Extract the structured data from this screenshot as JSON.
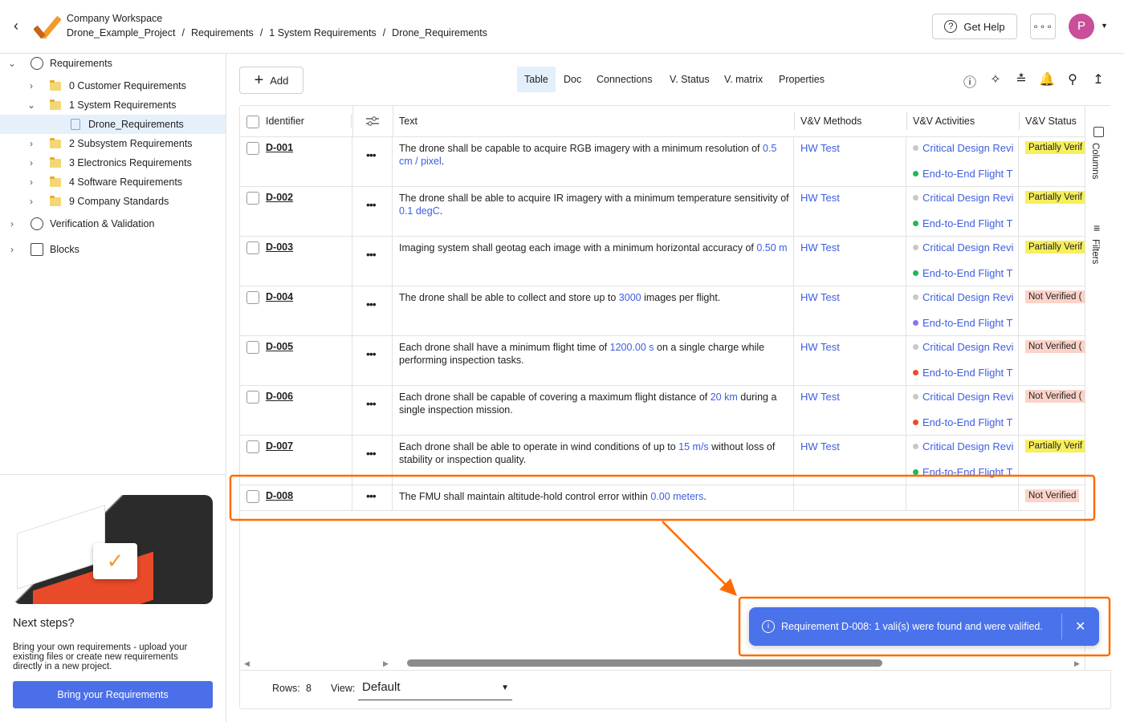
{
  "header": {
    "workspace": "Company Workspace",
    "breadcrumb": [
      "Drone_Example_Project",
      "Requirements",
      "1 System Requirements",
      "Drone_Requirements"
    ],
    "help_label": "Get Help",
    "avatar_letter": "P",
    "avatar_color": "#c94f9b"
  },
  "sidebar": {
    "items": [
      {
        "label": "Requirements",
        "level": 0,
        "expanded": true,
        "icon": "requirements-icon"
      },
      {
        "label": "0 Customer Requirements",
        "level": 1,
        "expanded": false,
        "icon": "folder-icon"
      },
      {
        "label": "1 System Requirements",
        "level": 1,
        "expanded": true,
        "icon": "folder-icon"
      },
      {
        "label": "Drone_Requirements",
        "level": 2,
        "selected": true,
        "icon": "document-icon"
      },
      {
        "label": "2 Subsystem Requirements",
        "level": 1,
        "expanded": false,
        "icon": "folder-icon"
      },
      {
        "label": "3 Electronics Requirements",
        "level": 1,
        "expanded": false,
        "icon": "folder-icon"
      },
      {
        "label": "4 Software Requirements",
        "level": 1,
        "expanded": false,
        "icon": "folder-icon"
      },
      {
        "label": "9 Company Standards",
        "level": 1,
        "expanded": false,
        "icon": "folder-icon"
      },
      {
        "label": "Verification & Validation",
        "level": 0,
        "expanded": false,
        "icon": "verification-icon"
      },
      {
        "label": "Blocks",
        "level": 0,
        "expanded": false,
        "icon": "blocks-icon"
      }
    ],
    "promo": {
      "title": "Next steps?",
      "body": "Bring your own requirements - upload your existing files or create new requirements directly in a new project.",
      "button": "Bring your Requirements"
    }
  },
  "toolbar": {
    "add_label": "Add",
    "tabs": [
      "Table",
      "Doc",
      "Connections",
      "V. Status",
      "V. matrix",
      "Properties"
    ],
    "active_tab": "Table",
    "icons": [
      "info-icon",
      "sparkle-icon",
      "chart-icon",
      "bell-icon",
      "search-icon",
      "upload-icon"
    ]
  },
  "table": {
    "columns": [
      "Identifier",
      "Text",
      "V&V Methods",
      "V&V Activities",
      "V&V Status"
    ],
    "side_panel": [
      "Columns",
      "Filters"
    ],
    "rows": [
      {
        "id": "D-001",
        "text": [
          [
            "The drone shall be capable to acquire RGB imagery with a minimum resolution of ",
            0
          ],
          [
            "0.5  cm / pixel",
            1
          ],
          [
            ".",
            0
          ]
        ],
        "method": "HW Test",
        "activities": [
          [
            "Critical Design Revi",
            "#c8c8c8"
          ],
          [
            "End-to-End Flight T",
            "#1db954"
          ]
        ],
        "status": "Partially Verif",
        "status_color": "#f7ef5b"
      },
      {
        "id": "D-002",
        "text": [
          [
            "The drone shall be able to acquire IR imagery with a minimum temperature sensitivity of ",
            0
          ],
          [
            "0.1  degC",
            1
          ],
          [
            ".",
            0
          ]
        ],
        "method": "HW Test",
        "activities": [
          [
            "Critical Design Revi",
            "#c8c8c8"
          ],
          [
            "End-to-End Flight T",
            "#1db954"
          ]
        ],
        "status": "Partially Verif",
        "status_color": "#f7ef5b"
      },
      {
        "id": "D-003",
        "text": [
          [
            "Imaging system shall geotag each image with a minimum horizontal accuracy of ",
            0
          ],
          [
            "0.50  m",
            1
          ]
        ],
        "method": "HW Test",
        "activities": [
          [
            "Critical Design Revi",
            "#c8c8c8"
          ],
          [
            "End-to-End Flight T",
            "#1db954"
          ]
        ],
        "status": "Partially Verif",
        "status_color": "#f7ef5b"
      },
      {
        "id": "D-004",
        "text": [
          [
            "The drone shall be able to collect and store up to ",
            0
          ],
          [
            "3000",
            1
          ],
          [
            " images per flight.",
            0
          ]
        ],
        "method": "HW Test",
        "activities": [
          [
            "Critical Design Revi",
            "#c8c8c8"
          ],
          [
            "End-to-End Flight T",
            "#8577ee"
          ]
        ],
        "status": "Not Verified (",
        "status_color": "#fbd3c8"
      },
      {
        "id": "D-005",
        "text": [
          [
            "Each drone shall have a minimum flight time of ",
            0
          ],
          [
            "1200.00  s",
            1
          ],
          [
            " on a single charge while performing inspection tasks.",
            0
          ]
        ],
        "method": "HW Test",
        "activities": [
          [
            "Critical Design Revi",
            "#c8c8c8"
          ],
          [
            "End-to-End Flight T",
            "#f04a2f"
          ]
        ],
        "status": "Not Verified (",
        "status_color": "#fbd3c8"
      },
      {
        "id": "D-006",
        "text": [
          [
            "Each drone shall be capable of covering a maximum flight distance of ",
            0
          ],
          [
            "20  km",
            1
          ],
          [
            " during a single inspection mission.",
            0
          ]
        ],
        "method": "HW Test",
        "activities": [
          [
            "Critical Design Revi",
            "#c8c8c8"
          ],
          [
            "End-to-End Flight T",
            "#f04a2f"
          ]
        ],
        "status": "Not Verified (",
        "status_color": "#fbd3c8"
      },
      {
        "id": "D-007",
        "text": [
          [
            "Each drone shall be able to operate in wind conditions of up to ",
            0
          ],
          [
            "15  m/s",
            1
          ],
          [
            " without loss of stability or inspection quality.",
            0
          ]
        ],
        "method": "HW Test",
        "activities": [
          [
            "Critical Design Revi",
            "#c8c8c8"
          ],
          [
            "End-to-End Flight T",
            "#1db954"
          ]
        ],
        "status": "Partially Verif",
        "status_color": "#f7ef5b"
      },
      {
        "id": "D-008",
        "text": [
          [
            "The FMU shall maintain altitude-hold control error within ",
            0
          ],
          [
            "0.00  meters",
            1
          ],
          [
            ".",
            0
          ]
        ],
        "method": "",
        "activities": [],
        "status": "Not Verified",
        "status_color": "#fbd3c8"
      }
    ]
  },
  "footer": {
    "rows_label": "Rows:",
    "rows_count": "8",
    "view_label": "View:",
    "view_value": "Default"
  },
  "toast": {
    "message": "Requirement D-008: 1 vali(s) were found and were valified.",
    "color": "#4a72ea"
  },
  "annotation_color": "#ff6a00"
}
